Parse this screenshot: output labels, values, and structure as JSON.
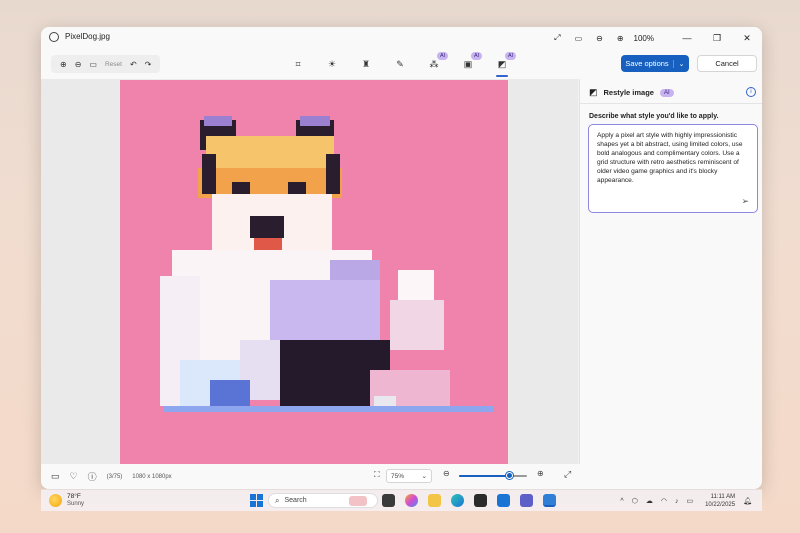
{
  "window": {
    "title": "PixelDog.jpg",
    "zoom_label": "100%"
  },
  "toolbar": {
    "reset_label": "Reset",
    "ai_badge": "AI",
    "save_label": "Save options",
    "cancel_label": "Cancel"
  },
  "panel": {
    "title": "Restyle image",
    "ai_badge": "AI",
    "prompt_label": "Describe what style you'd like to apply.",
    "prompt_text": "Apply a pixel art style with highly impressionistic shapes yet a bit abstract, using limited colors, use bold analogous and complimentary colors. Use a grid structure with retro aesthetics reminiscent of older video game graphics and it's blocky appearance."
  },
  "status": {
    "index": "(3/75)",
    "dimensions": "1080 x 1080px",
    "zoom_value": "75%",
    "zoom_fraction": 0.75
  },
  "taskbar": {
    "temp": "78°F",
    "weather": "Sunny",
    "search_placeholder": "Search",
    "time": "11:11 AM",
    "date": "10/22/2025"
  },
  "colors": {
    "accent": "#1760bf",
    "ai_badge": "#c8b3f1",
    "photo_bg": "#f083ac"
  }
}
